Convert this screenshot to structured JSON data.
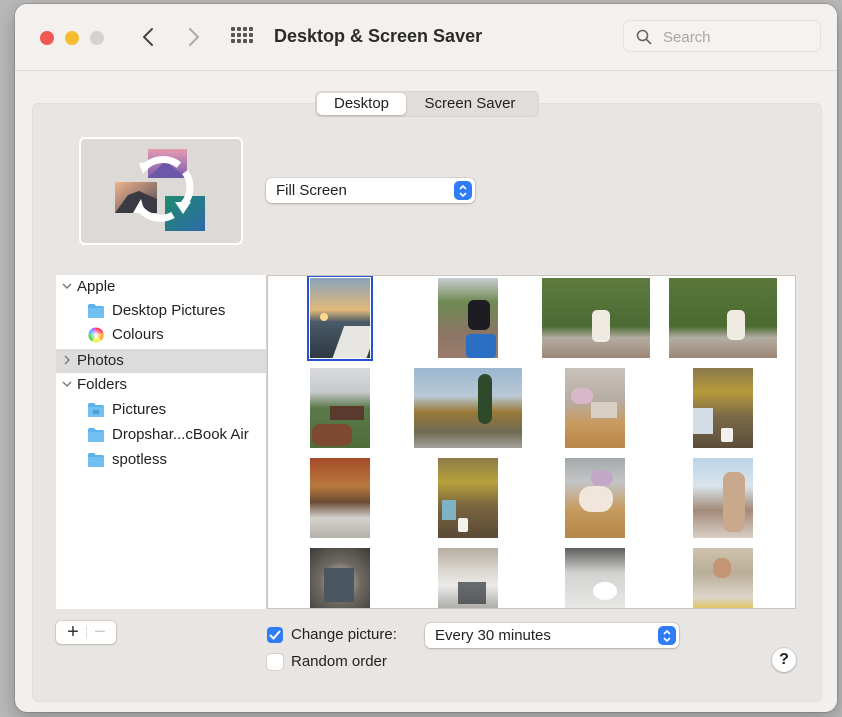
{
  "window": {
    "title": "Desktop & Screen Saver",
    "search_placeholder": "Search"
  },
  "tabs": [
    {
      "label": "Desktop",
      "active": true
    },
    {
      "label": "Screen Saver",
      "active": false
    }
  ],
  "fit_mode": {
    "selected": "Fill Screen"
  },
  "sidebar": {
    "groups": [
      {
        "label": "Apple",
        "expanded": true,
        "items": [
          {
            "label": "Desktop Pictures",
            "icon": "folder-icon"
          },
          {
            "label": "Colours",
            "icon": "color-wheel-icon"
          }
        ]
      },
      {
        "label": "Photos",
        "expanded": false,
        "selected": true,
        "items": []
      },
      {
        "label": "Folders",
        "expanded": true,
        "items": [
          {
            "label": "Pictures",
            "icon": "pictures-folder-icon"
          },
          {
            "label": "Dropshar...cBook Air",
            "icon": "folder-icon"
          },
          {
            "label": "spotless",
            "icon": "folder-icon"
          }
        ]
      }
    ]
  },
  "photos": [
    {
      "desc": "Sunset over water from boat",
      "selected": true
    },
    {
      "desc": "Woman by blue barrel"
    },
    {
      "desc": "Woman sitting on boat by reeds"
    },
    {
      "desc": "Woman sitting on boat by reeds 2"
    },
    {
      "desc": "Old sailing ship and flowers"
    },
    {
      "desc": "Autumn park with poplar tree"
    },
    {
      "desc": "Flowers and laptop on table"
    },
    {
      "desc": "Yellow leaves and coffee cup"
    },
    {
      "desc": "Autumn vines and table"
    },
    {
      "desc": "Yellow leaves, laptop and coffee"
    },
    {
      "desc": "Bouquet of flowers on table"
    },
    {
      "desc": "Woman smiling at cafe"
    },
    {
      "desc": "Painting on lit wall"
    },
    {
      "desc": "Gallery interior with people"
    },
    {
      "desc": "Table setting with plates"
    },
    {
      "desc": "Man at cafe counter"
    }
  ],
  "buttons": {
    "add": "+",
    "remove": "−",
    "help": "?"
  },
  "options": {
    "change_picture": {
      "label": "Change picture:",
      "checked": true
    },
    "interval": {
      "selected": "Every 30 minutes"
    },
    "random_order": {
      "label": "Random order",
      "checked": false
    }
  },
  "colors": {
    "accent": "#2f7cf6",
    "selection_outline": "#2552d6",
    "close": "#ee5a52",
    "minimize": "#f5bd2f",
    "zoom_disabled": "#d5d2cf"
  }
}
